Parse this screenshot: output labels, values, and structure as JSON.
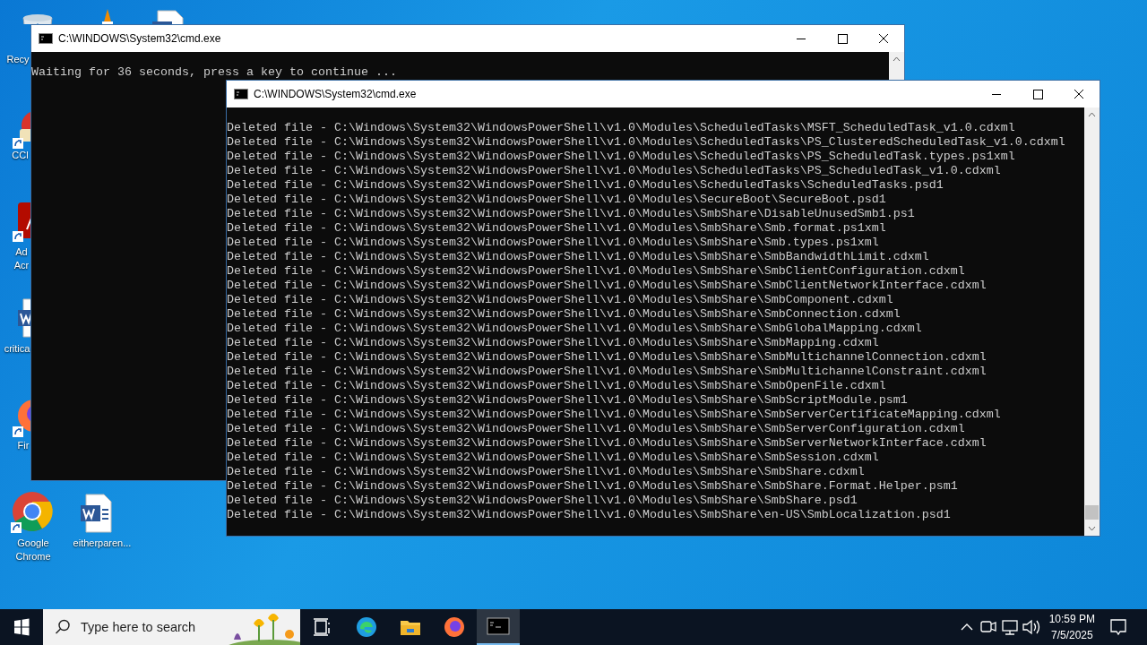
{
  "desktop_icons": [
    {
      "kind": "recycle",
      "label": "Recy"
    },
    {
      "kind": "vlc"
    },
    {
      "kind": "word"
    },
    {
      "kind": "ccleaner",
      "label": "CCl",
      "shortcut": true
    },
    {
      "kind": "acrobat",
      "label": "Ad Acr",
      "shortcut": true
    },
    {
      "kind": "word",
      "label": "critica",
      "shortcut": false
    },
    {
      "kind": "firefox",
      "label": "Fir",
      "shortcut": true
    },
    {
      "kind": "chrome",
      "label": "Google Chrome",
      "shortcut": true
    },
    {
      "kind": "word",
      "label": "eitherparen...",
      "shortcut": false
    }
  ],
  "windows": [
    {
      "title": "C:\\WINDOWS\\System32\\cmd.exe",
      "lines": [
        "Waiting for 36 seconds, press a key to continue ..."
      ]
    },
    {
      "title": "C:\\WINDOWS\\System32\\cmd.exe",
      "lines": [
        "Deleted file - C:\\Windows\\System32\\WindowsPowerShell\\v1.0\\Modules\\ScheduledTasks\\MSFT_ScheduledTask_v1.0.cdxml",
        "Deleted file - C:\\Windows\\System32\\WindowsPowerShell\\v1.0\\Modules\\ScheduledTasks\\PS_ClusteredScheduledTask_v1.0.cdxml",
        "Deleted file - C:\\Windows\\System32\\WindowsPowerShell\\v1.0\\Modules\\ScheduledTasks\\PS_ScheduledTask.types.ps1xml",
        "Deleted file - C:\\Windows\\System32\\WindowsPowerShell\\v1.0\\Modules\\ScheduledTasks\\PS_ScheduledTask_v1.0.cdxml",
        "Deleted file - C:\\Windows\\System32\\WindowsPowerShell\\v1.0\\Modules\\ScheduledTasks\\ScheduledTasks.psd1",
        "Deleted file - C:\\Windows\\System32\\WindowsPowerShell\\v1.0\\Modules\\SecureBoot\\SecureBoot.psd1",
        "Deleted file - C:\\Windows\\System32\\WindowsPowerShell\\v1.0\\Modules\\SmbShare\\DisableUnusedSmb1.ps1",
        "Deleted file - C:\\Windows\\System32\\WindowsPowerShell\\v1.0\\Modules\\SmbShare\\Smb.format.ps1xml",
        "Deleted file - C:\\Windows\\System32\\WindowsPowerShell\\v1.0\\Modules\\SmbShare\\Smb.types.ps1xml",
        "Deleted file - C:\\Windows\\System32\\WindowsPowerShell\\v1.0\\Modules\\SmbShare\\SmbBandwidthLimit.cdxml",
        "Deleted file - C:\\Windows\\System32\\WindowsPowerShell\\v1.0\\Modules\\SmbShare\\SmbClientConfiguration.cdxml",
        "Deleted file - C:\\Windows\\System32\\WindowsPowerShell\\v1.0\\Modules\\SmbShare\\SmbClientNetworkInterface.cdxml",
        "Deleted file - C:\\Windows\\System32\\WindowsPowerShell\\v1.0\\Modules\\SmbShare\\SmbComponent.cdxml",
        "Deleted file - C:\\Windows\\System32\\WindowsPowerShell\\v1.0\\Modules\\SmbShare\\SmbConnection.cdxml",
        "Deleted file - C:\\Windows\\System32\\WindowsPowerShell\\v1.0\\Modules\\SmbShare\\SmbGlobalMapping.cdxml",
        "Deleted file - C:\\Windows\\System32\\WindowsPowerShell\\v1.0\\Modules\\SmbShare\\SmbMapping.cdxml",
        "Deleted file - C:\\Windows\\System32\\WindowsPowerShell\\v1.0\\Modules\\SmbShare\\SmbMultichannelConnection.cdxml",
        "Deleted file - C:\\Windows\\System32\\WindowsPowerShell\\v1.0\\Modules\\SmbShare\\SmbMultichannelConstraint.cdxml",
        "Deleted file - C:\\Windows\\System32\\WindowsPowerShell\\v1.0\\Modules\\SmbShare\\SmbOpenFile.cdxml",
        "Deleted file - C:\\Windows\\System32\\WindowsPowerShell\\v1.0\\Modules\\SmbShare\\SmbScriptModule.psm1",
        "Deleted file - C:\\Windows\\System32\\WindowsPowerShell\\v1.0\\Modules\\SmbShare\\SmbServerCertificateMapping.cdxml",
        "Deleted file - C:\\Windows\\System32\\WindowsPowerShell\\v1.0\\Modules\\SmbShare\\SmbServerConfiguration.cdxml",
        "Deleted file - C:\\Windows\\System32\\WindowsPowerShell\\v1.0\\Modules\\SmbShare\\SmbServerNetworkInterface.cdxml",
        "Deleted file - C:\\Windows\\System32\\WindowsPowerShell\\v1.0\\Modules\\SmbShare\\SmbSession.cdxml",
        "Deleted file - C:\\Windows\\System32\\WindowsPowerShell\\v1.0\\Modules\\SmbShare\\SmbShare.cdxml",
        "Deleted file - C:\\Windows\\System32\\WindowsPowerShell\\v1.0\\Modules\\SmbShare\\SmbShare.Format.Helper.psm1",
        "Deleted file - C:\\Windows\\System32\\WindowsPowerShell\\v1.0\\Modules\\SmbShare\\SmbShare.psd1",
        "Deleted file - C:\\Windows\\System32\\WindowsPowerShell\\v1.0\\Modules\\SmbShare\\en-US\\SmbLocalization.psd1"
      ]
    }
  ],
  "taskbar": {
    "search": {
      "placeholder": "Type here to search"
    },
    "apps": [
      {
        "kind": "taskview",
        "selected": false
      },
      {
        "kind": "edge",
        "selected": false
      },
      {
        "kind": "explorer",
        "selected": false
      },
      {
        "kind": "firefox",
        "selected": false
      },
      {
        "kind": "cmd",
        "selected": true
      }
    ],
    "time": "10:59 PM",
    "date": "7/5/2025"
  }
}
